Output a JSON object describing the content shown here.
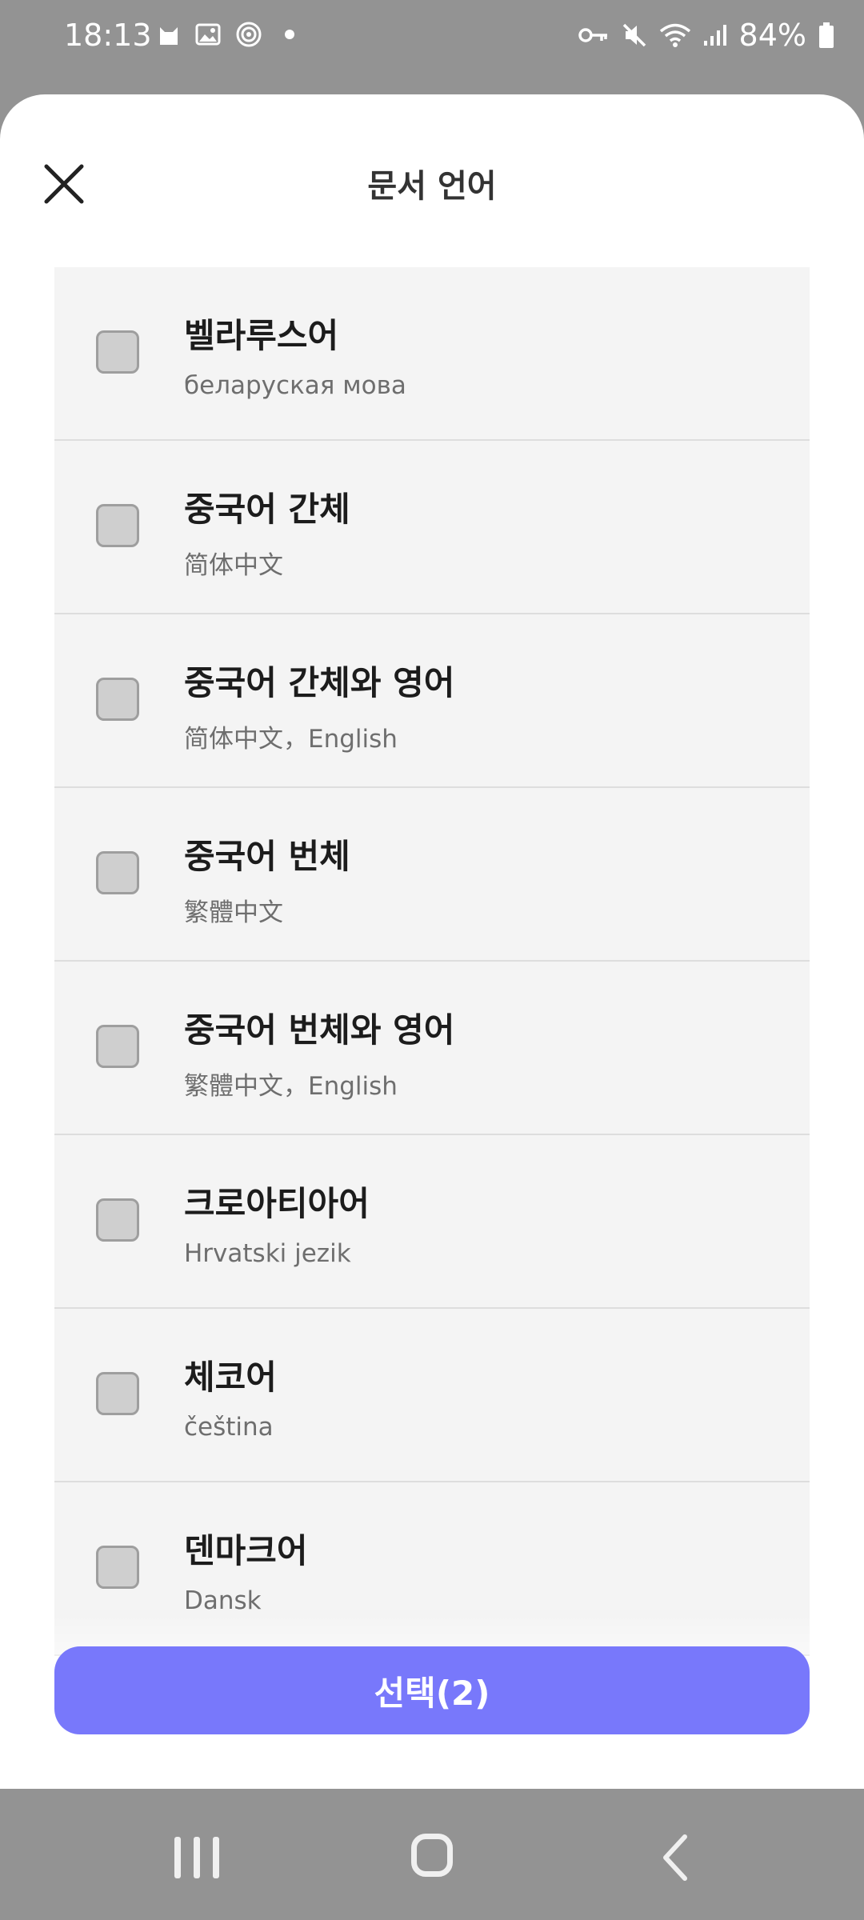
{
  "status_bar": {
    "time": "18:13",
    "battery": "84%",
    "left_icons": [
      "cat-app-icon",
      "gallery-icon",
      "nfc-icon",
      "dot-icon"
    ],
    "right_icons": [
      "vpn-key-icon",
      "mute-icon",
      "wifi-icon",
      "signal-icon",
      "battery-icon"
    ]
  },
  "sheet": {
    "title": "문서 언어",
    "close_icon": "close-icon",
    "items": [
      {
        "title": "벨라루스어",
        "subtitle": "беларуская мова"
      },
      {
        "title": "중국어 간체",
        "subtitle": "简体中文"
      },
      {
        "title": "중국어 간체와 영어",
        "subtitle": "简体中文，English"
      },
      {
        "title": "중국어 번체",
        "subtitle": "繁體中文"
      },
      {
        "title": "중국어 번체와 영어",
        "subtitle": "繁體中文，English"
      },
      {
        "title": "크로아티아어",
        "subtitle": "Hrvatski jezik"
      },
      {
        "title": "체코어",
        "subtitle": "čeština"
      },
      {
        "title": "덴마크어",
        "subtitle": "Dansk"
      }
    ],
    "select_button": "선택(2)",
    "accent_color": "#7878fb"
  },
  "nav_bar": {
    "icons": [
      "recents-icon",
      "home-icon",
      "back-icon"
    ]
  }
}
